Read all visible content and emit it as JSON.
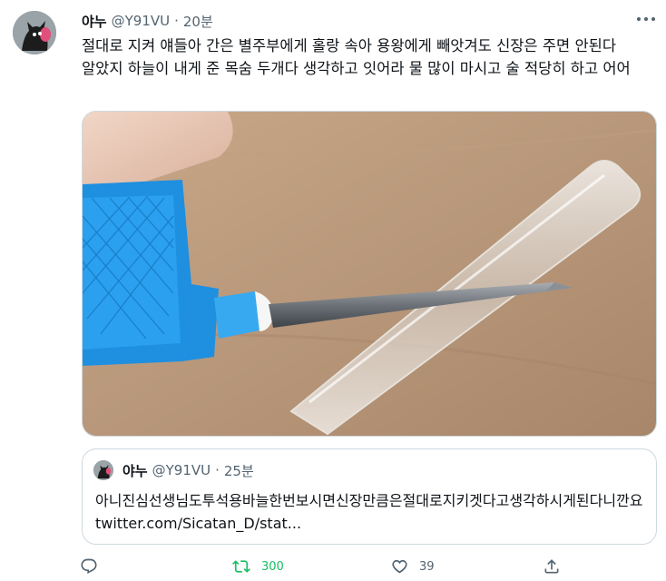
{
  "tweet": {
    "display_name": "야누",
    "handle": "@Y91VU",
    "separator": "·",
    "time": "20분",
    "text": "절대로 지켜 얘들아 간은 별주부에게 홀랑 속아 용왕에게 빼앗겨도 신장은 주면 안된다 알았지 하늘이 내게 준 목숨 두개다 생각하고 잇어라 물 많이 마시고 술 적당히 하고 어어"
  },
  "quote": {
    "display_name": "야누",
    "handle": "@Y91VU",
    "separator": "·",
    "time": "25분",
    "text": "아니진심선생님도투석용바늘한번보시면신장만큼은절대로지키겟다고생각하시게된다니깐요 twitter.com/Sicatan_D/stat..."
  },
  "actions": {
    "reply_count": "",
    "retweet_count": "300",
    "like_count": "39"
  },
  "icons": [
    "more-icon",
    "reply-icon",
    "retweet-icon",
    "like-icon",
    "share-icon"
  ],
  "colors": {
    "text_primary": "#0f1419",
    "text_secondary": "#536471",
    "retweet_green": "#17bf63",
    "border": "#cfd9de"
  }
}
